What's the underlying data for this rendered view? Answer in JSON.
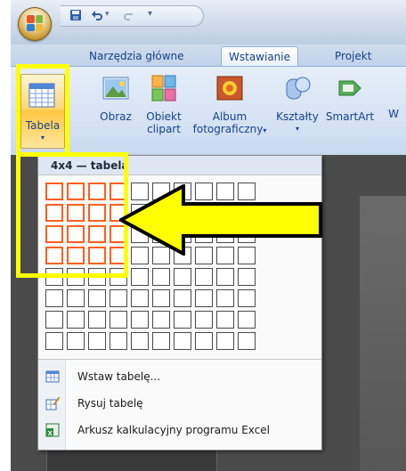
{
  "tabs": [
    {
      "label": "Narzędzia główne",
      "active": false
    },
    {
      "label": "Wstawianie",
      "active": true
    },
    {
      "label": "Projekt",
      "active": false
    }
  ],
  "ribbon": {
    "tabela": {
      "label": "Tabela"
    },
    "obraz": {
      "label": "Obraz"
    },
    "clipart": {
      "line1": "Obiekt",
      "line2": "clipart"
    },
    "album": {
      "line1": "Album",
      "line2": "fotograficzny"
    },
    "ksztalty": {
      "label": "Kształty"
    },
    "smartart": {
      "label": "SmartArt"
    },
    "cut": {
      "label": "W"
    }
  },
  "table_menu": {
    "header": "4x4 — tabela",
    "grid_cols": 10,
    "grid_rows": 8,
    "selected_cols": 4,
    "selected_rows": 4,
    "items": [
      {
        "label": "Wstaw tabelę...",
        "icon": "insert-table-icon"
      },
      {
        "label": "Rysuj tabelę",
        "icon": "draw-table-icon"
      },
      {
        "label": "Arkusz kalkulacyjny programu Excel",
        "icon": "excel-sheet-icon"
      }
    ]
  },
  "colors": {
    "highlight": "#ffff00",
    "selected_cell": "#ff5f1f",
    "tab_text": "#15428b"
  }
}
